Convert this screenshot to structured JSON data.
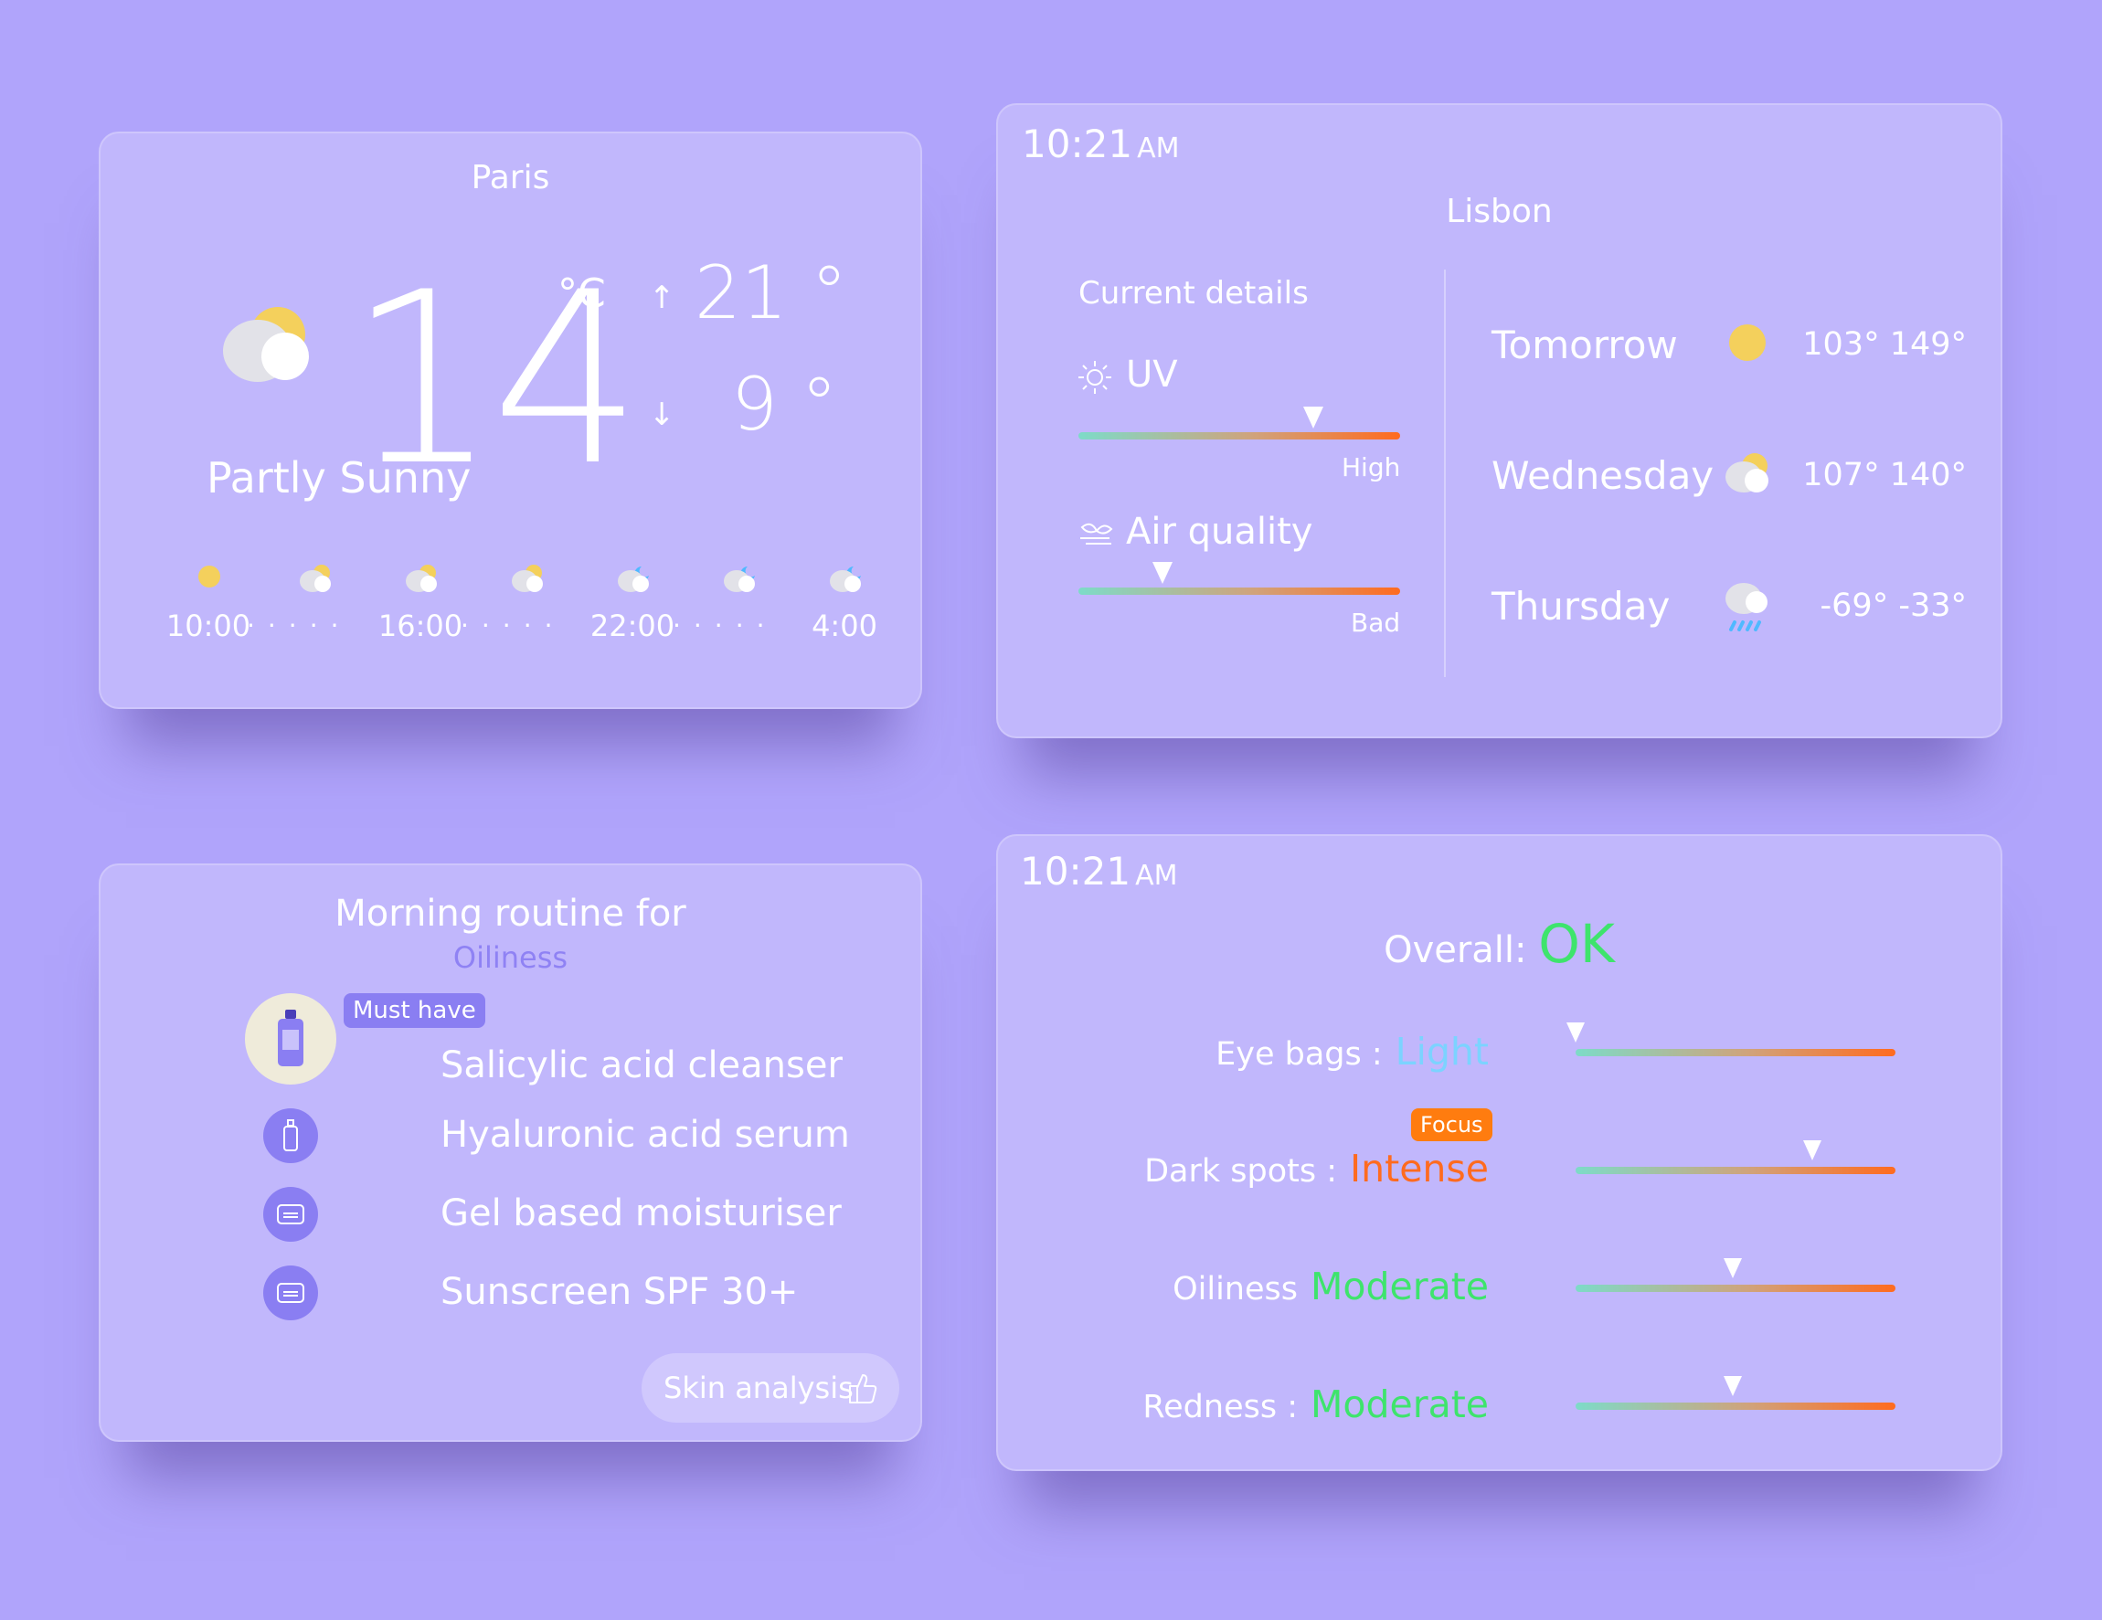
{
  "colors": {
    "background": "#b0a4fb",
    "card": "#c1b7fc",
    "accent_purple": "#8a7ef2",
    "sun_yellow": "#f4d05c",
    "rain_blue": "#4fb9ff",
    "green": "#3ee46c",
    "orange": "#ff6b1f",
    "light_blue": "#7cd3ff",
    "gradient": [
      "#7ddbc8",
      "#d1a27a",
      "#ff6b1f"
    ]
  },
  "paris": {
    "city": "Paris",
    "temperature": "14",
    "unit": "°C",
    "high": "21 °",
    "low": "9 °",
    "condition": "Partly Sunny",
    "condition_icon": "partly-sunny-icon",
    "hourly": [
      {
        "time": "10:00",
        "icon": "sun-icon"
      },
      {
        "time": "",
        "icon": "partly-cloudy-day-icon"
      },
      {
        "time": "16:00",
        "icon": "partly-cloudy-day-icon"
      },
      {
        "time": "",
        "icon": "partly-cloudy-day-icon"
      },
      {
        "time": "22:00",
        "icon": "partly-cloudy-night-icon"
      },
      {
        "time": "",
        "icon": "partly-cloudy-night-icon"
      },
      {
        "time": "4:00",
        "icon": "partly-cloudy-night-icon"
      }
    ]
  },
  "lisbon": {
    "time": "10:21",
    "ampm": "AM",
    "city": "Lisbon",
    "current_details": "Current details",
    "uv": {
      "label": "UV",
      "level_text": "High",
      "level": 0.73
    },
    "air_quality": {
      "label": "Air quality",
      "level_text": "Bad",
      "level": 0.26
    },
    "forecast": [
      {
        "day": "Tomorrow",
        "icon": "sun-icon",
        "temps": "103° 149°"
      },
      {
        "day": "Wednesday",
        "icon": "partly-sunny-icon",
        "temps": "107° 140°"
      },
      {
        "day": "Thursday",
        "icon": "rain-icon",
        "temps": "-69° -33°"
      }
    ]
  },
  "routine": {
    "title": "Morning routine for",
    "subtitle": "Oiliness",
    "badge": "Must have",
    "items": [
      {
        "label": "Salicylic acid cleanser",
        "icon": "cleanser-bottle-icon"
      },
      {
        "label": "Hyaluronic acid serum",
        "icon": "serum-bottle-icon"
      },
      {
        "label": "Gel based moisturiser",
        "icon": "jar-icon"
      },
      {
        "label": "Sunscreen SPF 30+",
        "icon": "jar-icon"
      }
    ],
    "skin_analysis": "Skin analysis"
  },
  "skin": {
    "time": "10:21",
    "ampm": "AM",
    "overall_label": "Overall:",
    "overall_value": "OK",
    "focus_badge": "Focus",
    "metrics": [
      {
        "label": "Eye bags :",
        "value": "Light",
        "color": "#7cd3ff",
        "level": 0.0
      },
      {
        "label": "Dark spots :",
        "value": "Intense",
        "color": "#ff6b1f",
        "level": 0.74
      },
      {
        "label": "Oiliness",
        "value": "Moderate",
        "color": "#3ee46c",
        "level": 0.49
      },
      {
        "label": "Redness :",
        "value": "Moderate",
        "color": "#3ee46c",
        "level": 0.49
      }
    ]
  }
}
